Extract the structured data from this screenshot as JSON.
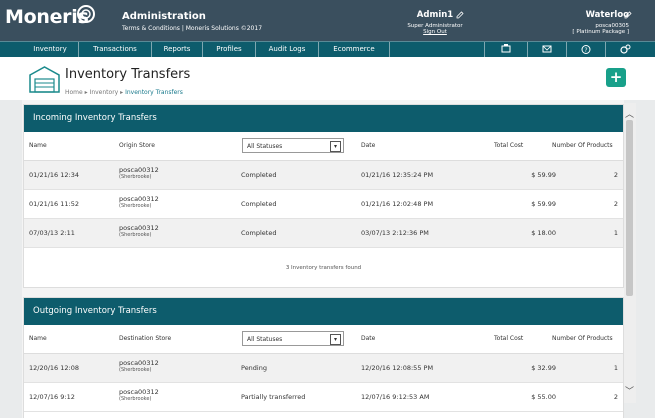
{
  "brand": {
    "logo_text": "Moneris"
  },
  "header": {
    "title": "Administration",
    "subtitle": "Terms & Conditions | Moneris Solutions ©2017",
    "user": {
      "name": "Admin1",
      "role": "Super Administrator",
      "signout": "Sign Out"
    },
    "store": {
      "name": "Waterloo",
      "id": "posca00305",
      "package": "[ Platinum Package ]"
    }
  },
  "nav": {
    "items": [
      "Inventory",
      "Transactions",
      "Reports",
      "Profiles",
      "Audit Logs",
      "Ecommerce"
    ],
    "icons": [
      "register-icon",
      "mail-icon",
      "help-icon",
      "settings-icon"
    ]
  },
  "page": {
    "title": "Inventory Transfers",
    "breadcrumb": [
      "Home",
      "Inventory",
      "Inventory Transfers"
    ],
    "add_label": "+"
  },
  "incoming": {
    "title": "Incoming Inventory Transfers",
    "columns": {
      "name": "Name",
      "store": "Origin Store",
      "status": "All Statuses",
      "date": "Date",
      "cost": "Total Cost",
      "products": "Number Of Products"
    },
    "rows": [
      {
        "name": "01/21/16 12:34",
        "store": "posca00312",
        "store_sub": "(Sherbrooke)",
        "status": "Completed",
        "date": "01/21/16 12:35:24 PM",
        "cost": "$ 59.99",
        "products": "2"
      },
      {
        "name": "01/21/16 11:52",
        "store": "posca00312",
        "store_sub": "(Sherbrooke)",
        "status": "Completed",
        "date": "01/21/16 12:02:48 PM",
        "cost": "$ 59.99",
        "products": "2"
      },
      {
        "name": "07/03/13 2:11",
        "store": "posca00312",
        "store_sub": "(Sherbrooke)",
        "status": "Completed",
        "date": "03/07/13 2:12:36 PM",
        "cost": "$ 18.00",
        "products": "1"
      }
    ],
    "count_text": "3 Inventory transfers found"
  },
  "outgoing": {
    "title": "Outgoing Inventory Transfers",
    "columns": {
      "name": "Name",
      "store": "Destination Store",
      "status": "All Statuses",
      "date": "Date",
      "cost": "Total Cost",
      "products": "Number Of Products"
    },
    "rows": [
      {
        "name": "12/20/16 12:08",
        "store": "posca00312",
        "store_sub": "(Sherbrooke)",
        "status": "Pending",
        "date": "12/20/16 12:08:55 PM",
        "cost": "$ 32.99",
        "products": "1"
      },
      {
        "name": "12/07/16 9:12",
        "store": "posca00312",
        "store_sub": "(Sherbrooke)",
        "status": "Partially transferred",
        "date": "12/07/16 9:12:53 AM",
        "cost": "$ 55.00",
        "products": "2"
      }
    ]
  },
  "colors": {
    "topbar": "#3a4f5e",
    "nav": "#0d5c6c",
    "accent": "#18a08a"
  }
}
